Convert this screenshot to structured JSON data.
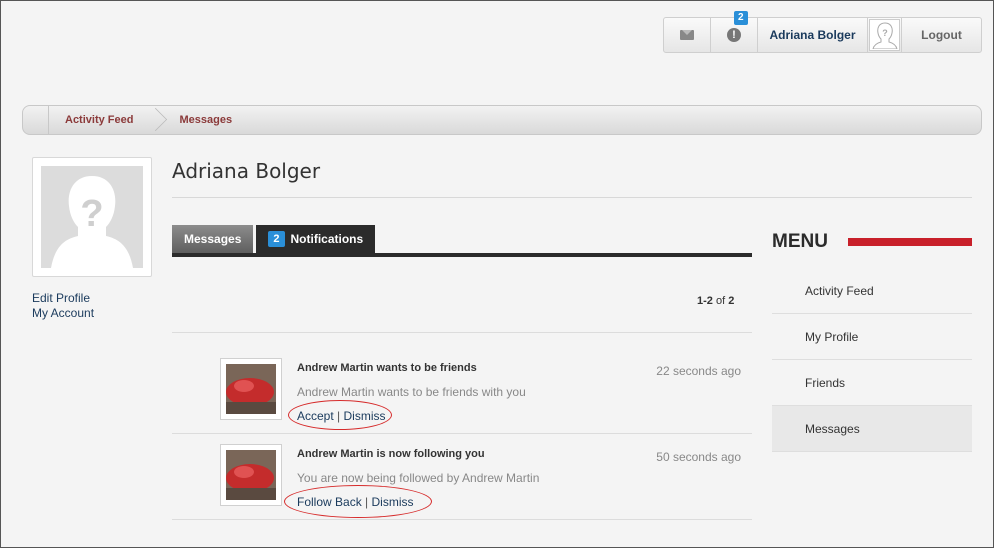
{
  "userbar": {
    "mail_icon": "envelope-icon",
    "alert_icon": "alert-circle-icon",
    "alert_badge": "2",
    "alert_symbol": "!",
    "user_name": "Adriana Bolger",
    "logout_label": "Logout"
  },
  "breadcrumb": {
    "items": [
      "Activity Feed",
      "Messages"
    ]
  },
  "profile": {
    "name": "Adriana Bolger",
    "links": [
      "Edit Profile",
      "My Account"
    ]
  },
  "tabs": {
    "messages_label": "Messages",
    "notifications_badge": "2",
    "notifications_label": "Notifications"
  },
  "pager": {
    "range": "1-2",
    "of": "of",
    "total": "2"
  },
  "notifications": [
    {
      "title": "Andrew Martin wants to be friends",
      "time": "22 seconds ago",
      "body": "Andrew Martin wants to be friends with you",
      "action1": "Accept",
      "separator": "|",
      "action2": "Dismiss"
    },
    {
      "title": "Andrew Martin is now following you",
      "time": "50 seconds ago",
      "body": "You are now being followed by Andrew Martin",
      "action1": "Follow Back",
      "separator": "|",
      "action2": "Dismiss"
    }
  ],
  "menu": {
    "title": "MENU",
    "items": [
      "Activity Feed",
      "My Profile",
      "Friends",
      "Messages"
    ],
    "active_index": 3
  },
  "colors": {
    "accent_red": "#c8202a",
    "badge_blue": "#2a8fd8",
    "link_blue": "#1a3a5c",
    "crumb_red": "#8b3a3a"
  }
}
